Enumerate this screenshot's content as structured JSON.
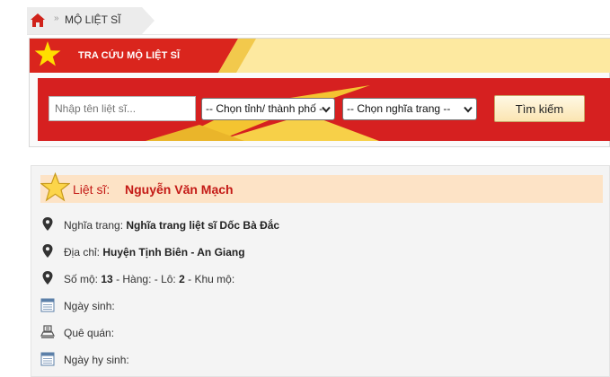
{
  "breadcrumb": {
    "separator": "»",
    "current": "MỘ LIỆT SĨ"
  },
  "search": {
    "title": "TRA CỨU MỘ LIỆT SĨ",
    "name_placeholder": "Nhập tên liệt sĩ...",
    "name_value": "",
    "province_selected": "-- Chọn tỉnh/ thành phố --",
    "cemetery_selected": "-- Chọn nghĩa trang --",
    "button_label": "Tìm kiếm"
  },
  "detail": {
    "title_prefix": "Liệt sĩ:",
    "name": "Nguyễn Văn Mạch",
    "cemetery_label": "Nghĩa trang:",
    "cemetery_value": "Nghĩa trang liệt sĩ Dốc Bà Đắc",
    "address_label": "Địa chỉ:",
    "address_value": "Huyện Tịnh Biên - An Giang",
    "grave_label": "Số mộ:",
    "grave_number": "13",
    "row_label": "- Hàng: - Lô:",
    "lot_number": "2",
    "area_label": "- Khu mộ:",
    "birth_label": "Ngày sinh:",
    "hometown_label": "Quê quán:",
    "death_label": "Ngày hy sinh:"
  },
  "colors": {
    "flag_red": "#da251d",
    "flag_yellow": "#ffde00",
    "title_red": "#c41a16",
    "title_bar": "#fde3c6"
  },
  "icons": [
    "home-icon",
    "flag-star-icon",
    "star-icon",
    "map-pin-icon",
    "calendar-icon",
    "monument-icon"
  ]
}
